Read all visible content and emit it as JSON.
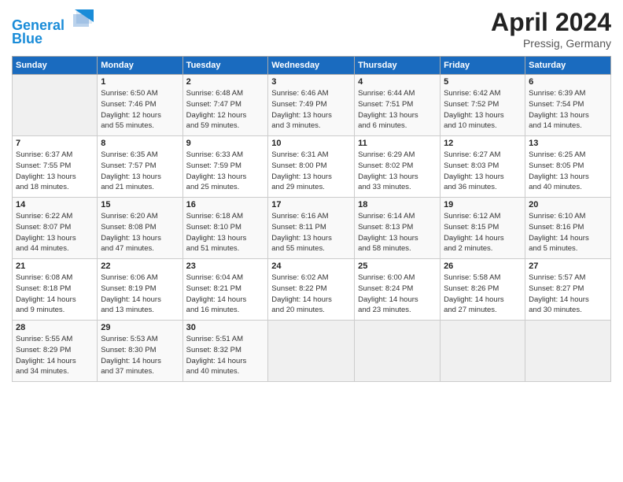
{
  "header": {
    "logo_line1": "General",
    "logo_line2": "Blue",
    "month": "April 2024",
    "location": "Pressig, Germany"
  },
  "weekdays": [
    "Sunday",
    "Monday",
    "Tuesday",
    "Wednesday",
    "Thursday",
    "Friday",
    "Saturday"
  ],
  "weeks": [
    [
      {
        "day": "",
        "info": ""
      },
      {
        "day": "1",
        "info": "Sunrise: 6:50 AM\nSunset: 7:46 PM\nDaylight: 12 hours\nand 55 minutes."
      },
      {
        "day": "2",
        "info": "Sunrise: 6:48 AM\nSunset: 7:47 PM\nDaylight: 12 hours\nand 59 minutes."
      },
      {
        "day": "3",
        "info": "Sunrise: 6:46 AM\nSunset: 7:49 PM\nDaylight: 13 hours\nand 3 minutes."
      },
      {
        "day": "4",
        "info": "Sunrise: 6:44 AM\nSunset: 7:51 PM\nDaylight: 13 hours\nand 6 minutes."
      },
      {
        "day": "5",
        "info": "Sunrise: 6:42 AM\nSunset: 7:52 PM\nDaylight: 13 hours\nand 10 minutes."
      },
      {
        "day": "6",
        "info": "Sunrise: 6:39 AM\nSunset: 7:54 PM\nDaylight: 13 hours\nand 14 minutes."
      }
    ],
    [
      {
        "day": "7",
        "info": "Sunrise: 6:37 AM\nSunset: 7:55 PM\nDaylight: 13 hours\nand 18 minutes."
      },
      {
        "day": "8",
        "info": "Sunrise: 6:35 AM\nSunset: 7:57 PM\nDaylight: 13 hours\nand 21 minutes."
      },
      {
        "day": "9",
        "info": "Sunrise: 6:33 AM\nSunset: 7:59 PM\nDaylight: 13 hours\nand 25 minutes."
      },
      {
        "day": "10",
        "info": "Sunrise: 6:31 AM\nSunset: 8:00 PM\nDaylight: 13 hours\nand 29 minutes."
      },
      {
        "day": "11",
        "info": "Sunrise: 6:29 AM\nSunset: 8:02 PM\nDaylight: 13 hours\nand 33 minutes."
      },
      {
        "day": "12",
        "info": "Sunrise: 6:27 AM\nSunset: 8:03 PM\nDaylight: 13 hours\nand 36 minutes."
      },
      {
        "day": "13",
        "info": "Sunrise: 6:25 AM\nSunset: 8:05 PM\nDaylight: 13 hours\nand 40 minutes."
      }
    ],
    [
      {
        "day": "14",
        "info": "Sunrise: 6:22 AM\nSunset: 8:07 PM\nDaylight: 13 hours\nand 44 minutes."
      },
      {
        "day": "15",
        "info": "Sunrise: 6:20 AM\nSunset: 8:08 PM\nDaylight: 13 hours\nand 47 minutes."
      },
      {
        "day": "16",
        "info": "Sunrise: 6:18 AM\nSunset: 8:10 PM\nDaylight: 13 hours\nand 51 minutes."
      },
      {
        "day": "17",
        "info": "Sunrise: 6:16 AM\nSunset: 8:11 PM\nDaylight: 13 hours\nand 55 minutes."
      },
      {
        "day": "18",
        "info": "Sunrise: 6:14 AM\nSunset: 8:13 PM\nDaylight: 13 hours\nand 58 minutes."
      },
      {
        "day": "19",
        "info": "Sunrise: 6:12 AM\nSunset: 8:15 PM\nDaylight: 14 hours\nand 2 minutes."
      },
      {
        "day": "20",
        "info": "Sunrise: 6:10 AM\nSunset: 8:16 PM\nDaylight: 14 hours\nand 5 minutes."
      }
    ],
    [
      {
        "day": "21",
        "info": "Sunrise: 6:08 AM\nSunset: 8:18 PM\nDaylight: 14 hours\nand 9 minutes."
      },
      {
        "day": "22",
        "info": "Sunrise: 6:06 AM\nSunset: 8:19 PM\nDaylight: 14 hours\nand 13 minutes."
      },
      {
        "day": "23",
        "info": "Sunrise: 6:04 AM\nSunset: 8:21 PM\nDaylight: 14 hours\nand 16 minutes."
      },
      {
        "day": "24",
        "info": "Sunrise: 6:02 AM\nSunset: 8:22 PM\nDaylight: 14 hours\nand 20 minutes."
      },
      {
        "day": "25",
        "info": "Sunrise: 6:00 AM\nSunset: 8:24 PM\nDaylight: 14 hours\nand 23 minutes."
      },
      {
        "day": "26",
        "info": "Sunrise: 5:58 AM\nSunset: 8:26 PM\nDaylight: 14 hours\nand 27 minutes."
      },
      {
        "day": "27",
        "info": "Sunrise: 5:57 AM\nSunset: 8:27 PM\nDaylight: 14 hours\nand 30 minutes."
      }
    ],
    [
      {
        "day": "28",
        "info": "Sunrise: 5:55 AM\nSunset: 8:29 PM\nDaylight: 14 hours\nand 34 minutes."
      },
      {
        "day": "29",
        "info": "Sunrise: 5:53 AM\nSunset: 8:30 PM\nDaylight: 14 hours\nand 37 minutes."
      },
      {
        "day": "30",
        "info": "Sunrise: 5:51 AM\nSunset: 8:32 PM\nDaylight: 14 hours\nand 40 minutes."
      },
      {
        "day": "",
        "info": ""
      },
      {
        "day": "",
        "info": ""
      },
      {
        "day": "",
        "info": ""
      },
      {
        "day": "",
        "info": ""
      }
    ]
  ]
}
